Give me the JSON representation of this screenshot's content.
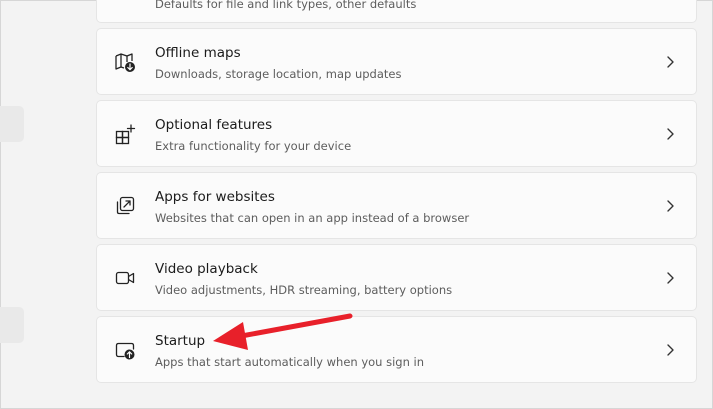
{
  "settings": {
    "items": [
      {
        "title": "",
        "desc": "Defaults for file and link types, other defaults",
        "icon": "default-apps-icon"
      },
      {
        "title": "Offline maps",
        "desc": "Downloads, storage location, map updates",
        "icon": "map-download-icon"
      },
      {
        "title": "Optional features",
        "desc": "Extra functionality for your device",
        "icon": "add-features-icon"
      },
      {
        "title": "Apps for websites",
        "desc": "Websites that can open in an app instead of a browser",
        "icon": "open-external-icon"
      },
      {
        "title": "Video playback",
        "desc": "Video adjustments, HDR streaming, battery options",
        "icon": "video-camera-icon"
      },
      {
        "title": "Startup",
        "desc": "Apps that start automatically when you sign in",
        "icon": "startup-icon"
      }
    ]
  },
  "annotation": {
    "arrow_color": "#e8202a"
  },
  "colors": {
    "background": "#f3f3f3",
    "card": "#fbfbfb",
    "border": "#e5e5e5"
  }
}
